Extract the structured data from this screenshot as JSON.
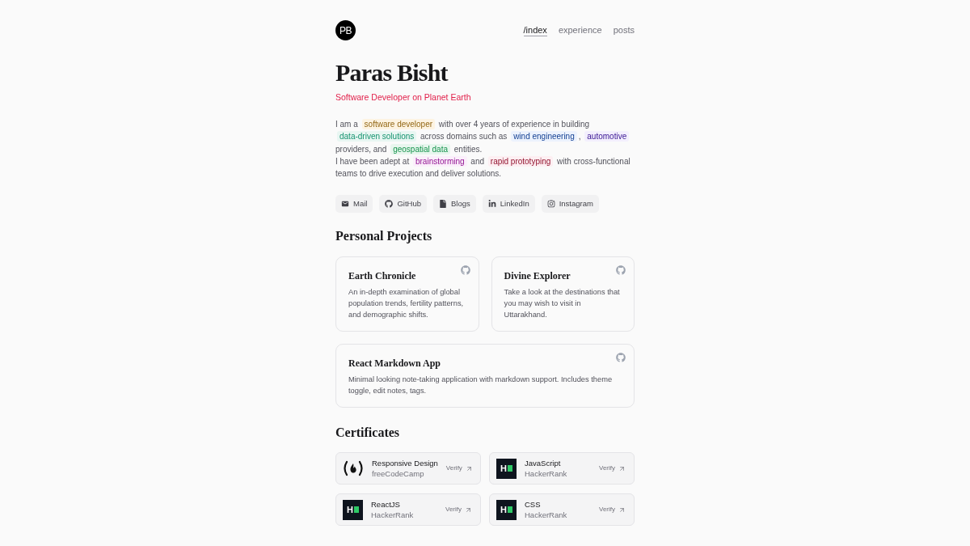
{
  "header": {
    "logo": "PB",
    "nav": [
      {
        "label": "/index",
        "selected": true
      },
      {
        "label": "experience",
        "selected": false
      },
      {
        "label": "posts",
        "selected": false
      }
    ]
  },
  "profile": {
    "name": "Paras Bisht",
    "tagline": "Software Developer on Planet Earth"
  },
  "intro": [
    {
      "segments": [
        {
          "kind": "text",
          "text": "I am a"
        },
        {
          "kind": "highlight",
          "text": "software developer",
          "color": "#fdf3e1"
        },
        {
          "kind": "text",
          "text": "with over 4 years of experience in building"
        },
        {
          "kind": "highlight",
          "text": "data‑driven solutions",
          "color": "#e8f6f2"
        },
        {
          "kind": "text",
          "text": "across domains such as"
        },
        {
          "kind": "highlight",
          "text": "wind engineering",
          "color": "#ecf2fd"
        },
        {
          "kind": "text",
          "text": ","
        },
        {
          "kind": "highlight",
          "text": "automotive",
          "color": "#f3effd"
        },
        {
          "kind": "text",
          "text": "providers, and"
        },
        {
          "kind": "highlight",
          "text": "geospatial data",
          "color": "#e8f6ee"
        },
        {
          "kind": "text",
          "text": "entities."
        }
      ]
    },
    {
      "segments": [
        {
          "kind": "text",
          "text": "I have been adept at"
        },
        {
          "kind": "highlight",
          "text": "brainstorming",
          "color": "#fbeffb"
        },
        {
          "kind": "text",
          "text": "and"
        },
        {
          "kind": "highlight",
          "text": "rapid prototyping",
          "color": "#fdeff2"
        },
        {
          "kind": "text",
          "text": "with cross‑functional teams to drive execution and deliver solutions."
        }
      ]
    }
  ],
  "links": [
    {
      "kind": "mail",
      "label": "Mail"
    },
    {
      "kind": "github",
      "label": "GitHub"
    },
    {
      "kind": "blogs",
      "label": "Blogs"
    },
    {
      "kind": "linkedin",
      "label": "LinkedIn"
    },
    {
      "kind": "instagram",
      "label": "Instagram"
    }
  ],
  "projects": {
    "title": "Personal Projects",
    "items": [
      {
        "title": "Earth Chronicle",
        "description": "An in-depth examination of global population trends, fertility patterns, and demographic shifts."
      },
      {
        "title": "Divine Explorer",
        "description": "Take a look at the destinations that you may wish to visit in Uttarakhand."
      },
      {
        "title": "React Markdown App",
        "description": "Minimal looking note-taking application with markdown support. Includes theme toggle, edit notes, tags."
      }
    ]
  },
  "certificates": {
    "title": "Certificates",
    "items": [
      {
        "logo": {
          "kind": "freecodecamp"
        },
        "title": "Responsive Design",
        "issuer": "freeCodeCamp",
        "action": "Verify"
      },
      {
        "logo": {
          "kind": "hackerrank",
          "text": "H"
        },
        "title": "JavaScript",
        "issuer": "HackerRank",
        "action": "Verify"
      },
      {
        "logo": {
          "kind": "hackerrank",
          "text": "H"
        },
        "title": "ReactJS",
        "issuer": "HackerRank",
        "action": "Verify"
      },
      {
        "logo": {
          "kind": "hackerrank",
          "text": "H"
        },
        "title": "CSS",
        "issuer": "HackerRank",
        "action": "Verify"
      }
    ]
  }
}
